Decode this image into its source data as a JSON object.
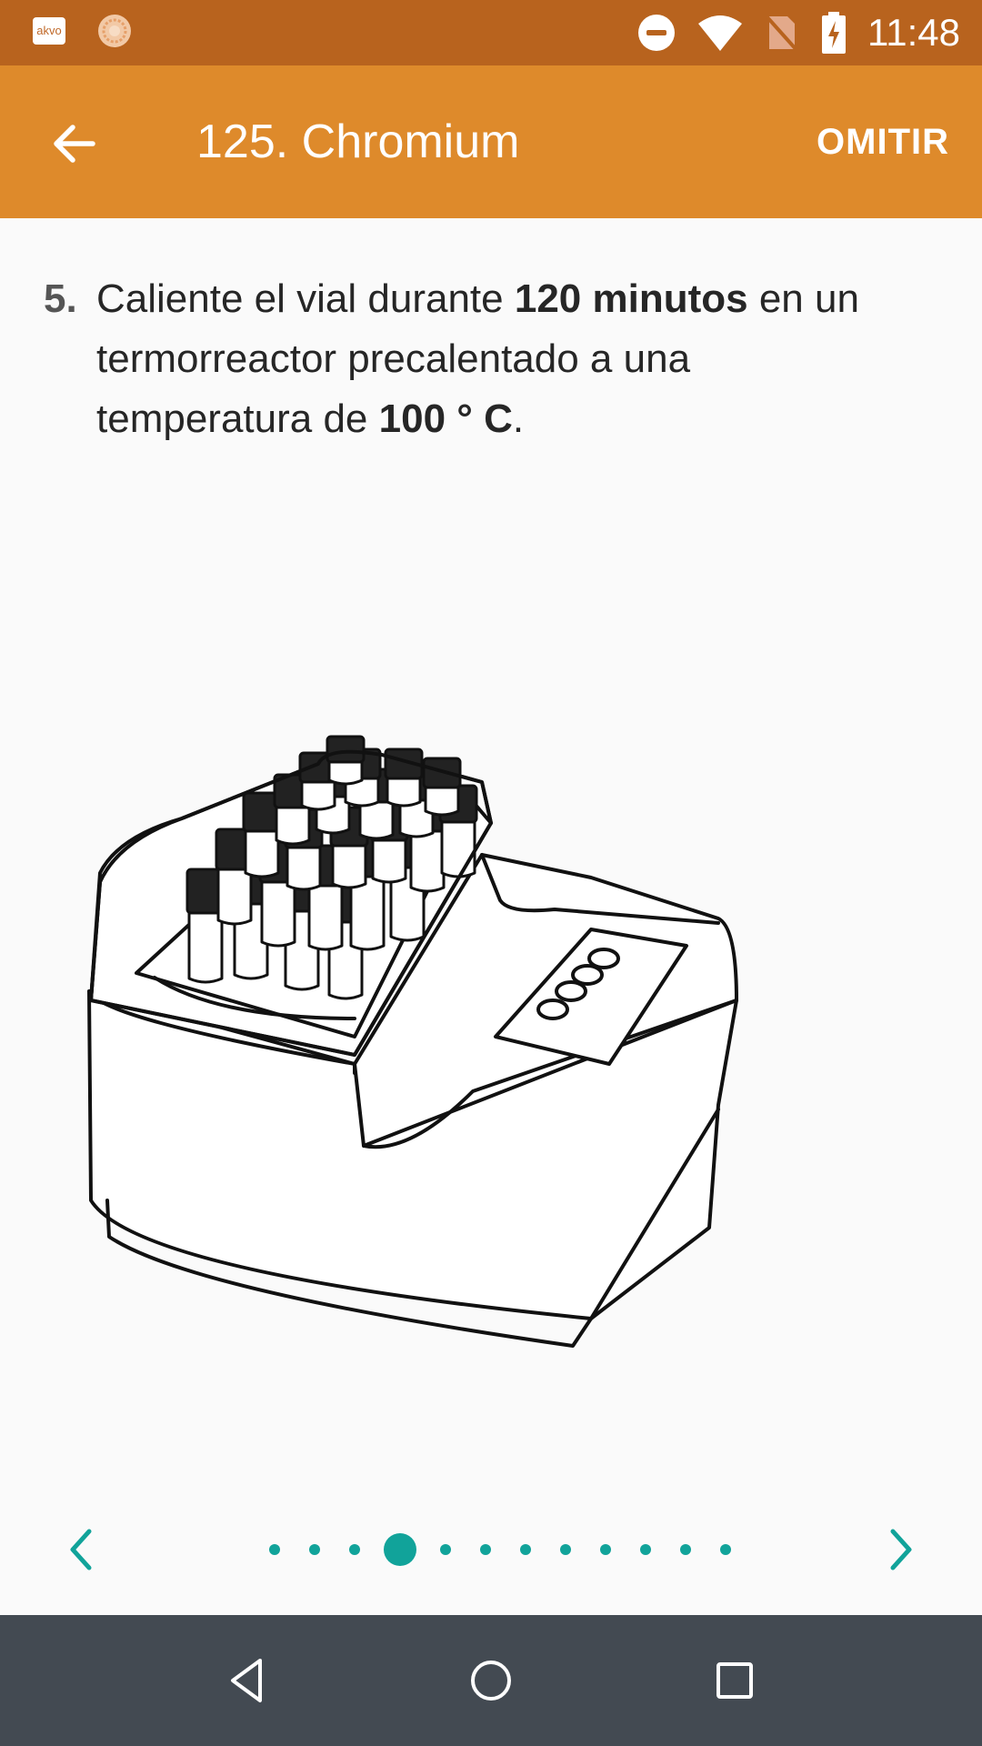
{
  "status_bar": {
    "time": "11:48",
    "logo_text": "akvo",
    "icons": [
      "akvo-logo",
      "sun-icon",
      "do-not-disturb-icon",
      "wifi-icon",
      "no-sim-icon",
      "battery-charging-icon"
    ],
    "background": "#b8631e"
  },
  "app_bar": {
    "title": "125. Chromium",
    "skip_label": "OMITIR",
    "back_icon": "arrow-left-icon",
    "background": "#de8a2b"
  },
  "instruction": {
    "step_number": "5.",
    "text_1": "Caliente el vial durante ",
    "bold_1": "120 minutos",
    "text_2": " en un termorreactor precalentado a una temperatura de ",
    "bold_2": "100 ° C",
    "text_3": "."
  },
  "illustration": {
    "subject": "thermoreactor-with-vials"
  },
  "pager": {
    "page_count": 12,
    "current_page": 4,
    "prev_icon": "chevron-left-icon",
    "next_icon": "chevron-right-icon",
    "accent": "#11a39a"
  },
  "nav_bar": {
    "icons": [
      "back-triangle-icon",
      "home-circle-icon",
      "recents-square-icon"
    ],
    "background": "#434a52"
  }
}
